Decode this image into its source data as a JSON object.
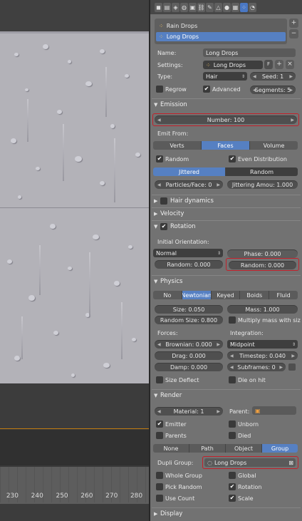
{
  "viewport": {
    "timeline_numbers": [
      "230",
      "240",
      "250",
      "260",
      "270",
      "280"
    ]
  },
  "particles": {
    "systems": [
      "Rain Drops",
      "Long Drops"
    ],
    "active_index": 1,
    "add_symbol": "+",
    "remove_symbol": "−",
    "name_label": "Name:",
    "name_value": "Long Drops",
    "settings_label": "Settings:",
    "settings_value": "Long Drops",
    "settings_fake_user": "F",
    "type_label": "Type:",
    "type_value": "Hair",
    "seed_label": "Seed: 1",
    "regrow_label": "Regrow",
    "advanced_label": "Advanced",
    "segments_label": "Segments: 5"
  },
  "emission": {
    "title": "Emission",
    "number_label": "Number: 100",
    "emit_from_label": "Emit From:",
    "emit_from_options": [
      "Verts",
      "Faces",
      "Volume"
    ],
    "emit_from_selected": "Faces",
    "random_label": "Random",
    "even_distribution_label": "Even Distribution",
    "distribution_options": [
      "Jittered",
      "Random"
    ],
    "distribution_selected": "Jittered",
    "particles_face_label": "Particles/Face: 0",
    "jittering_label": "Jittering Amou: 1.000"
  },
  "hair_dynamics": {
    "title": "Hair dynamics"
  },
  "velocity": {
    "title": "Velocity"
  },
  "rotation": {
    "title": "Rotation",
    "initial_orientation_label": "Initial Orientation:",
    "orientation_value": "Normal",
    "random_label": "Random: 0.000",
    "phase_label": "Phase: 0.000",
    "phase_random_label": "Random: 0.000"
  },
  "physics": {
    "title": "Physics",
    "modes": [
      "No",
      "Newtonian",
      "Keyed",
      "Boids",
      "Fluid"
    ],
    "mode_selected": "Newtonian",
    "size_label": "Size: 0.050",
    "mass_label": "Mass: 1.000",
    "random_size_label": "Random Size: 0.800",
    "multiply_mass_label": "Multiply mass with siz",
    "forces_label": "Forces:",
    "integration_label": "Integration:",
    "brownian_label": "Brownian: 0.000",
    "integration_value": "Midpoint",
    "drag_label": "Drag: 0.000",
    "timestep_label": "Timestep: 0.040",
    "damp_label": "Damp: 0.000",
    "subframes_label": "Subframes: 0",
    "size_deflect_label": "Size Deflect",
    "die_on_hit_label": "Die on hit"
  },
  "render": {
    "title": "Render",
    "material_label": "Material: 1",
    "parent_label": "Parent:",
    "emitter_label": "Emitter",
    "unborn_label": "Unborn",
    "parents_label": "Parents",
    "died_label": "Died",
    "render_modes": [
      "None",
      "Path",
      "Object",
      "Group"
    ],
    "render_selected": "Group",
    "dupli_group_label": "Dupli Group:",
    "dupli_group_value": "Long Drops",
    "whole_group_label": "Whole Group",
    "global_label": "Global",
    "pick_random_label": "Pick Random",
    "rotation_label": "Rotation",
    "use_count_label": "Use Count",
    "scale_label": "Scale"
  },
  "display": {
    "title": "Display"
  },
  "colors": {
    "selected_blue": "#5680c2",
    "highlight_red": "#c3202a",
    "panel_gray": "#727272"
  }
}
